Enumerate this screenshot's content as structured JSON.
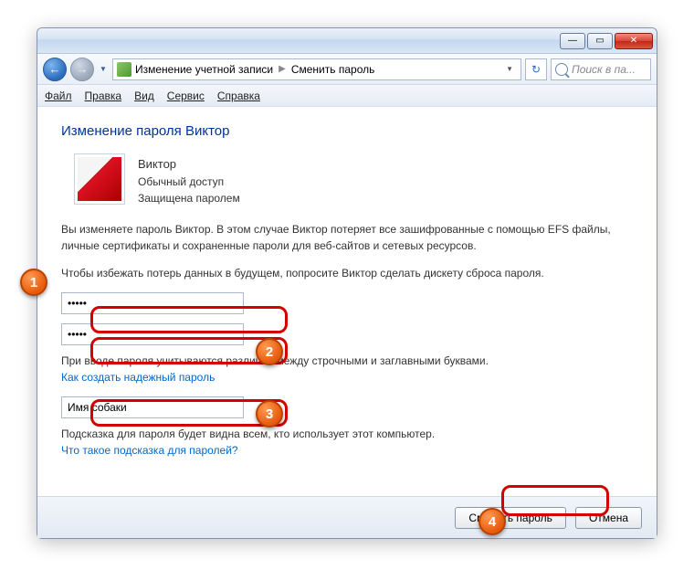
{
  "window": {
    "minimize": "—",
    "maximize": "▭",
    "close": "✕"
  },
  "nav": {
    "back": "←",
    "forward": "→",
    "breadcrumb1": "Изменение учетной записи",
    "breadcrumb2": "Сменить пароль",
    "refresh": "↻",
    "search_placeholder": "Поиск в па..."
  },
  "menu": {
    "file": "Файл",
    "edit": "Правка",
    "view": "Вид",
    "tools": "Сервис",
    "help": "Справка"
  },
  "page": {
    "heading": "Изменение пароля Виктор",
    "username": "Виктор",
    "access_level": "Обычный доступ",
    "protected": "Защищена паролем",
    "desc1": "Вы изменяете пароль Виктор. В этом случае Виктор потеряет все зашифрованные с помощью EFS файлы, личные сертификаты и сохраненные пароли для веб-сайтов и сетевых ресурсов.",
    "desc2": "Чтобы избежать потерь данных в будущем, попросите Виктор сделать дискету сброса пароля.",
    "password1": "•••••",
    "password2": "•••••",
    "case_note": "При вводе пароля учитываются различия между строчными и заглавными буквами.",
    "link_strong": "Как создать надежный пароль",
    "hint_value": "Имя собаки",
    "hint_note": "Подсказка для пароля будет видна всем, кто использует этот компьютер.",
    "link_hint": "Что такое подсказка для паролей?"
  },
  "footer": {
    "change": "Сменить пароль",
    "cancel": "Отмена"
  },
  "markers": {
    "m1": "1",
    "m2": "2",
    "m3": "3",
    "m4": "4"
  }
}
